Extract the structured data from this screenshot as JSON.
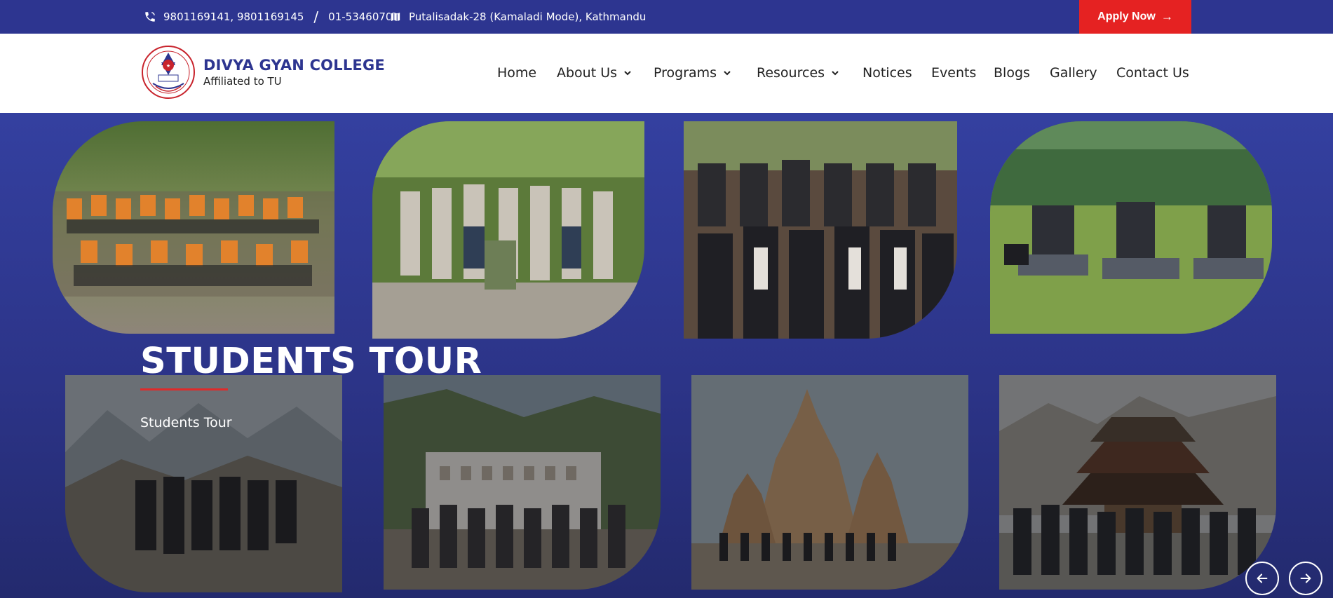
{
  "topbar": {
    "phones": "9801169141, 9801169145",
    "separator": "/",
    "landline": "01-5346070",
    "address": "Putalisadak-28 (Kamaladi Mode), Kathmandu",
    "apply_label": "Apply Now",
    "phone_icon": "phone-icon",
    "map_icon": "map-icon",
    "bg_color": "#2d3590",
    "apply_color": "#e52222"
  },
  "header": {
    "college_name": "DIVYA GYAN COLLEGE",
    "affiliation": "Affiliated to TU",
    "brand_color": "#2d3590"
  },
  "nav": {
    "items": [
      {
        "label": "Home",
        "dropdown": false
      },
      {
        "label": "About Us",
        "dropdown": true
      },
      {
        "label": "Programs",
        "dropdown": true
      },
      {
        "label": "Resources",
        "dropdown": true
      },
      {
        "label": "Notices",
        "dropdown": false
      },
      {
        "label": "Events",
        "dropdown": false
      },
      {
        "label": "Blogs",
        "dropdown": false
      },
      {
        "label": "Gallery",
        "dropdown": false
      },
      {
        "label": "Contact Us",
        "dropdown": false
      }
    ]
  },
  "hero": {
    "title": "STUDENTS TOUR",
    "subtitle": "Students Tour",
    "accent_color": "#e02a2a",
    "photos": [
      {
        "name": "photo-rafting-group"
      },
      {
        "name": "photo-garden-group"
      },
      {
        "name": "photo-stairs-group"
      },
      {
        "name": "photo-meadow-guitar"
      },
      {
        "name": "photo-mountain-group"
      },
      {
        "name": "photo-palace-group"
      },
      {
        "name": "photo-temple-group"
      },
      {
        "name": "photo-pagoda-group"
      }
    ],
    "prev_icon": "arrow-left-icon",
    "next_icon": "arrow-right-icon"
  }
}
